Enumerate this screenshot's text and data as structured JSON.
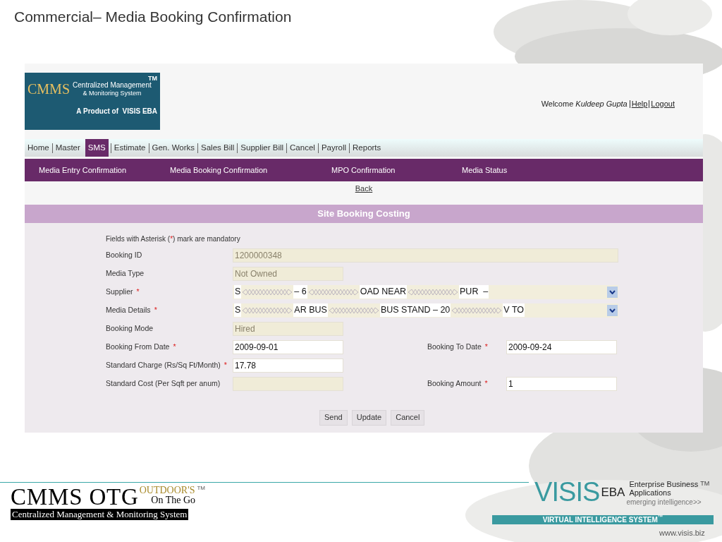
{
  "slide_title": "Commercial–  Media Booking Confirmation",
  "app": {
    "logo": {
      "mark": "CMMS",
      "tm": "TM",
      "line1": "Centralized Management",
      "line2": "& Monitoring System",
      "product": "A Product of  VISIS EBA"
    },
    "welcome": "Welcome *Kuldeep Gupta*",
    "links": [
      "Help",
      "Logout"
    ],
    "menu": [
      {
        "label": "Home",
        "selected": false
      },
      {
        "label": "Master",
        "selected": false
      },
      {
        "label": "SMS",
        "selected": true
      },
      {
        "label": "Estimate",
        "selected": false
      },
      {
        "label": "Gen. Works",
        "selected": false
      },
      {
        "label": "Sales Bill",
        "selected": false
      },
      {
        "label": "Supplier Bill",
        "selected": false
      },
      {
        "label": "Cancel",
        "selected": false
      },
      {
        "label": "Payroll",
        "selected": false
      },
      {
        "label": "Reports",
        "selected": false
      }
    ],
    "submenu": [
      "Media Entry Confirmation",
      "Media Booking Confirmation",
      "MPO Confirmation",
      "Media Status"
    ],
    "back_link": "Back",
    "section_title": "Site Booking Costing",
    "note": {
      "before": "Fields with Asterisk (",
      "mark": "*",
      "after": ") mark are mandatory"
    },
    "rows": [
      {
        "fields": [
          {
            "kind": "wide",
            "label": "Booking ID",
            "value": "1200000348",
            "disabled": true
          }
        ]
      },
      {
        "fields": [
          {
            "kind": "short",
            "label": "Media Type",
            "value": "Not Owned",
            "disabled": true
          }
        ]
      },
      {
        "fields": [
          {
            "kind": "select",
            "label": "Supplier",
            "required_mark": "*",
            "value_parts": [
              "S",
              "– 6",
              "OAD NEAR",
              "PUR  –"
            ]
          }
        ]
      },
      {
        "fields": [
          {
            "kind": "select",
            "label": "Media Details",
            "required_mark": "*",
            "value_parts": [
              "S",
              "AR BUS",
              "BUS STAND – 20",
              "V TO"
            ]
          }
        ]
      },
      {
        "fields": [
          {
            "kind": "short",
            "label": "Booking Mode",
            "value": "Hired",
            "disabled": true
          }
        ]
      },
      {
        "fields": [
          {
            "kind": "short",
            "label": "Booking From Date",
            "required_mark": "*",
            "value": "2009-09-01",
            "disabled": false
          },
          {
            "kind": "short",
            "label": "Booking To Date",
            "required_mark": "*",
            "value": "2009-09-24",
            "disabled": false
          }
        ]
      },
      {
        "fields": [
          {
            "kind": "short",
            "label": "Standard Charge (Rs/Sq Ft/Month)",
            "required_mark": "*",
            "value": "17.78",
            "disabled": false
          }
        ]
      },
      {
        "fields": [
          {
            "kind": "short",
            "label": "Standard Cost (Per Sqft per anum)",
            "disabled": true
          },
          {
            "kind": "short",
            "label": "Booking Amount",
            "required_mark": "*",
            "value": "1",
            "disabled": false
          }
        ]
      }
    ],
    "buttons": [
      "Send",
      "Update",
      "Cancel"
    ]
  },
  "footer": {
    "cmms_logo": {
      "name": "CMMS OTG",
      "outdoors": "OUTDOOR'S",
      "tm": "TM",
      "tagline": "On The Go",
      "subtitle": "Centralized Management & Monitoring System"
    },
    "visis_logo": {
      "name": "VISIS",
      "eba": "EBA",
      "line1": "Enterprise Business",
      "tm": "TM",
      "line2": "Applications",
      "slogan": "emerging intelligence>>"
    },
    "bar": "VIRTUAL INTELLIGENCE SYSTEM$^{™}$",
    "url": "www.visis.biz"
  }
}
